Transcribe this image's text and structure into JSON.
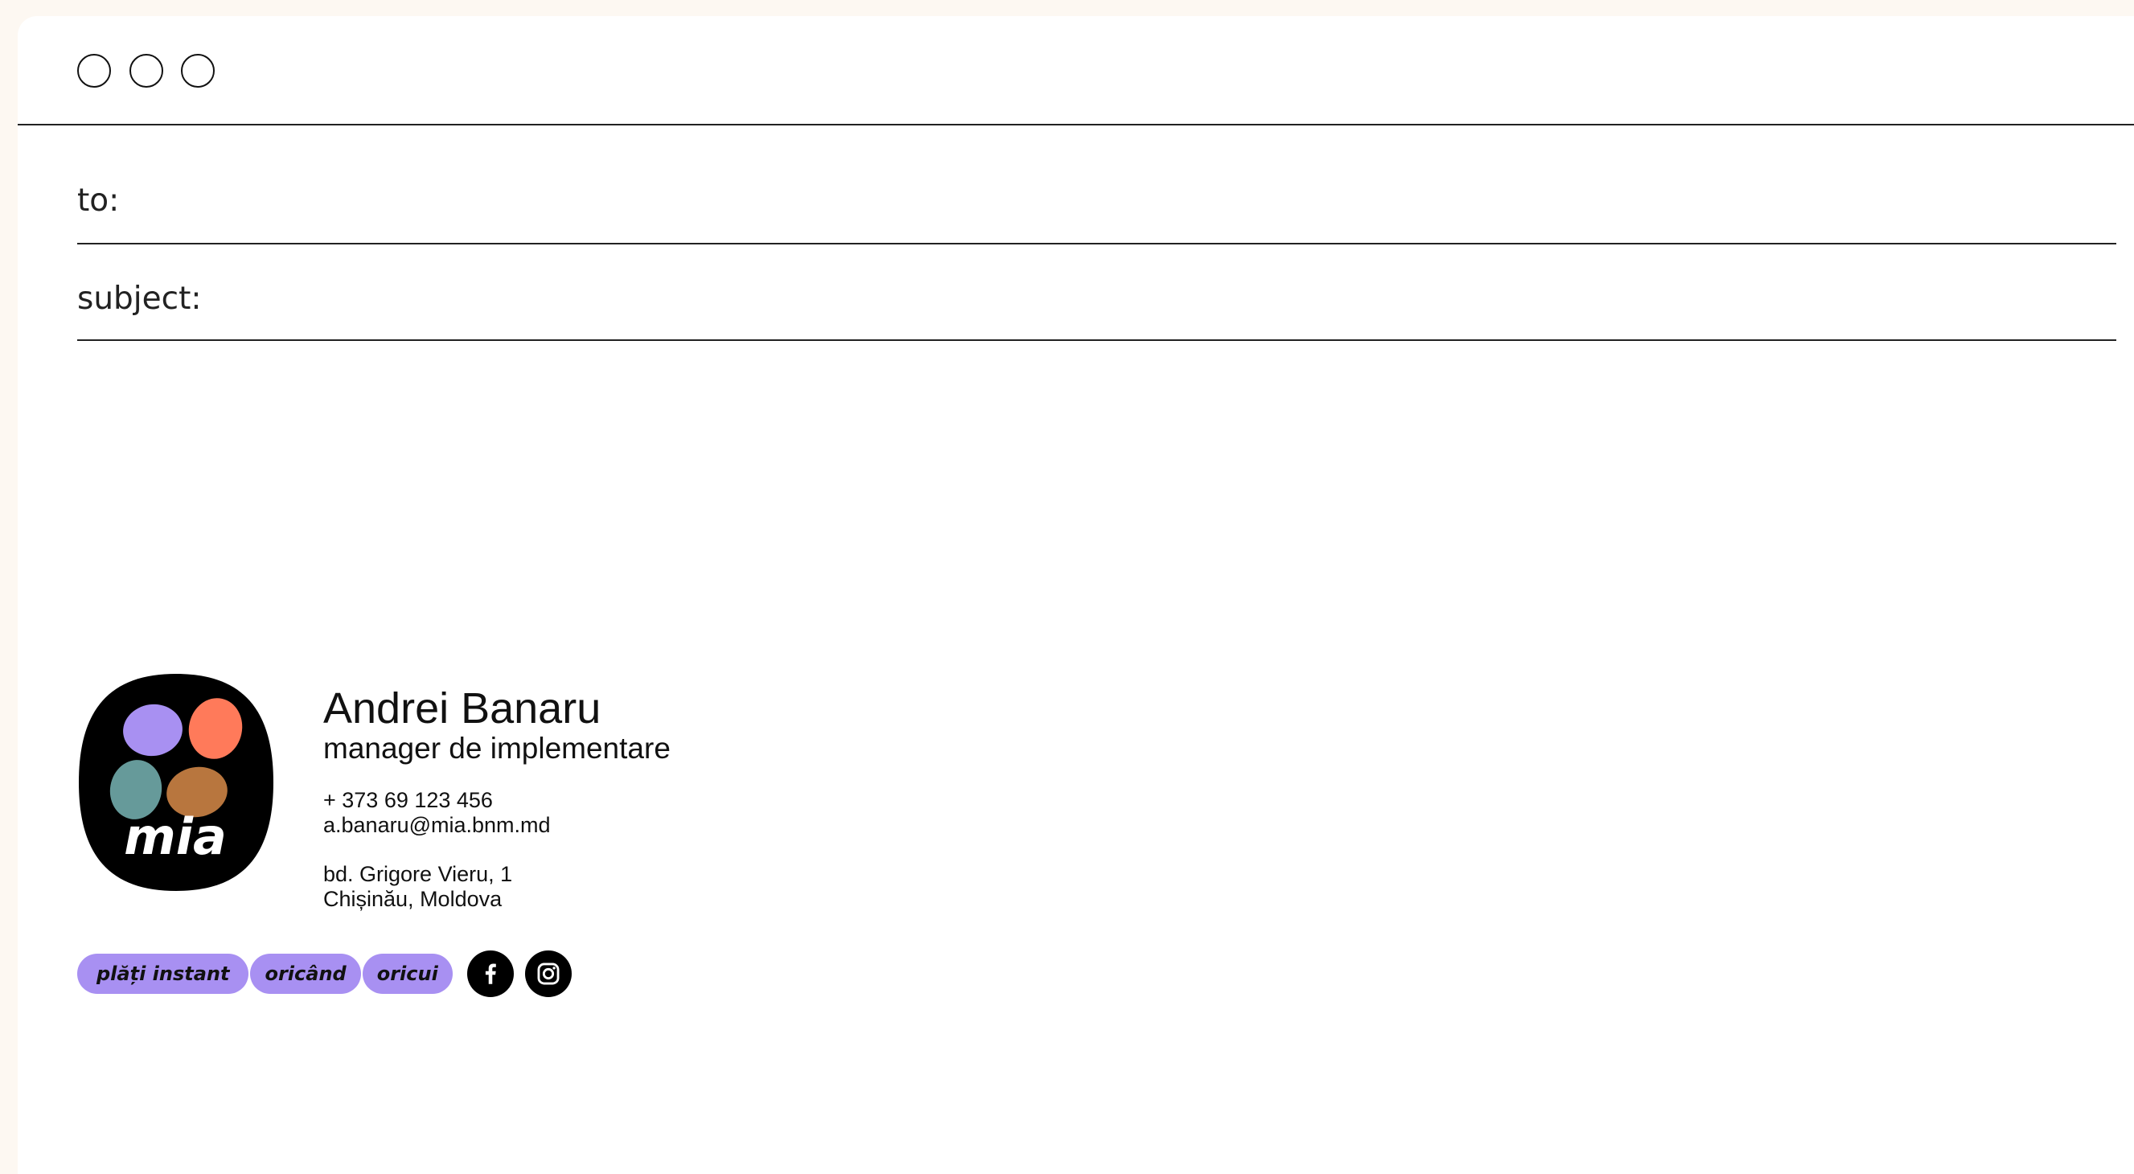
{
  "window": {
    "controls": [
      "close",
      "minimize",
      "maximize"
    ]
  },
  "compose": {
    "to_label": "to:",
    "to_value": "",
    "subject_label": "subject:",
    "subject_value": ""
  },
  "signature": {
    "logo_text": "mia",
    "name": "Andrei Banaru",
    "role": "manager de implementare",
    "phone": "+ 373 69 123 456",
    "email": "a.banaru@mia.bnm.md",
    "address_line1": "bd. Grigore Vieru, 1",
    "address_line2": "Chișinău, Moldova",
    "tags": [
      "plăți instant",
      "oricând",
      "oricui"
    ],
    "social": [
      "facebook-icon",
      "instagram-icon"
    ],
    "colors": {
      "tag_bg": "#a890f2",
      "blob_purple": "#a890f2",
      "blob_coral": "#ff7a5a",
      "blob_teal": "#669a9a",
      "blob_brown": "#b8763e",
      "logo_bg": "#000000"
    }
  }
}
